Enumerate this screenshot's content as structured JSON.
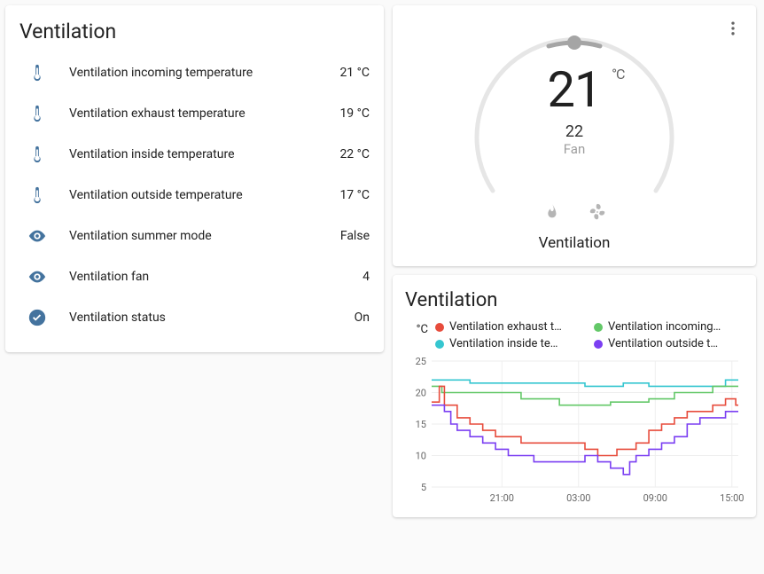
{
  "sensors_card": {
    "title": "Ventilation",
    "rows": [
      {
        "icon": "thermometer-icon",
        "label": "Ventilation incoming temperature",
        "value": "21 °C"
      },
      {
        "icon": "thermometer-icon",
        "label": "Ventilation exhaust temperature",
        "value": "19 °C"
      },
      {
        "icon": "thermometer-icon",
        "label": "Ventilation inside temperature",
        "value": "22 °C"
      },
      {
        "icon": "thermometer-icon",
        "label": "Ventilation outside temperature",
        "value": "17 °C"
      },
      {
        "icon": "eye-icon",
        "label": "Ventilation summer mode",
        "value": "False"
      },
      {
        "icon": "eye-icon",
        "label": "Ventilation fan",
        "value": "4"
      },
      {
        "icon": "check-circle-icon",
        "label": "Ventilation status",
        "value": "On"
      }
    ]
  },
  "thermostat": {
    "current_temp": "21",
    "unit": "°C",
    "target_temp": "22",
    "mode": "Fan",
    "name": "Ventilation",
    "buttons": {
      "heat": "heat",
      "fan": "fan"
    }
  },
  "chart": {
    "title": "Ventilation",
    "unit": "°C",
    "legend": [
      {
        "label": "Ventilation exhaust t…",
        "color": "#e74c3c"
      },
      {
        "label": "Ventilation incoming…",
        "color": "#63c868"
      },
      {
        "label": "Ventilation inside te…",
        "color": "#35c6d0"
      },
      {
        "label": "Ventilation outside t…",
        "color": "#7b3ff2"
      }
    ]
  },
  "chart_data": {
    "type": "line",
    "ylabel": "°C",
    "ylim": [
      5,
      25
    ],
    "yticks": [
      5,
      10,
      15,
      20,
      25
    ],
    "x_span_hours": 24,
    "xticks": [
      "21:00",
      "03:00",
      "09:00",
      "15:00"
    ],
    "xtick_hours": [
      5.5,
      11.5,
      17.5,
      23.5
    ],
    "series": [
      {
        "name": "Ventilation inside temperature",
        "color": "#35c6d0",
        "points": [
          [
            0,
            22
          ],
          [
            3,
            22
          ],
          [
            3,
            21.5
          ],
          [
            12,
            21.5
          ],
          [
            12,
            21
          ],
          [
            15,
            21
          ],
          [
            15,
            21.5
          ],
          [
            17,
            21.5
          ],
          [
            17,
            21
          ],
          [
            23,
            21
          ],
          [
            23,
            22
          ],
          [
            24,
            22
          ]
        ]
      },
      {
        "name": "Ventilation incoming temperature",
        "color": "#63c868",
        "points": [
          [
            0,
            21
          ],
          [
            0.8,
            21
          ],
          [
            0.8,
            20
          ],
          [
            7,
            20
          ],
          [
            7,
            19
          ],
          [
            10,
            19
          ],
          [
            10,
            18
          ],
          [
            14,
            18
          ],
          [
            14,
            18.5
          ],
          [
            17,
            18.5
          ],
          [
            17,
            19
          ],
          [
            19,
            19
          ],
          [
            19,
            20
          ],
          [
            22,
            20
          ],
          [
            22,
            21
          ],
          [
            24,
            21
          ]
        ]
      },
      {
        "name": "Ventilation exhaust temperature",
        "color": "#e74c3c",
        "points": [
          [
            0,
            18.5
          ],
          [
            0.6,
            18.5
          ],
          [
            0.6,
            21
          ],
          [
            1,
            21
          ],
          [
            1,
            18
          ],
          [
            2,
            18
          ],
          [
            2,
            16
          ],
          [
            3,
            16
          ],
          [
            3,
            15
          ],
          [
            4,
            15
          ],
          [
            4,
            14
          ],
          [
            5,
            14
          ],
          [
            5,
            13
          ],
          [
            7,
            13
          ],
          [
            7,
            12
          ],
          [
            12,
            12
          ],
          [
            12,
            11
          ],
          [
            13,
            11
          ],
          [
            13,
            10
          ],
          [
            14.5,
            10
          ],
          [
            14.5,
            11
          ],
          [
            16,
            11
          ],
          [
            16,
            12
          ],
          [
            17,
            12
          ],
          [
            17,
            14
          ],
          [
            18,
            14
          ],
          [
            18,
            15
          ],
          [
            19,
            15
          ],
          [
            19,
            16
          ],
          [
            20,
            16
          ],
          [
            20,
            17
          ],
          [
            22,
            17
          ],
          [
            22,
            18
          ],
          [
            23,
            18
          ],
          [
            23,
            19
          ],
          [
            23.8,
            19
          ],
          [
            23.8,
            18
          ],
          [
            24,
            18
          ]
        ]
      },
      {
        "name": "Ventilation outside temperature",
        "color": "#7b3ff2",
        "points": [
          [
            0,
            18
          ],
          [
            1,
            18
          ],
          [
            1,
            17
          ],
          [
            1.5,
            17
          ],
          [
            1.5,
            15
          ],
          [
            2,
            15
          ],
          [
            2,
            14
          ],
          [
            3,
            14
          ],
          [
            3,
            13
          ],
          [
            4,
            13
          ],
          [
            4,
            12
          ],
          [
            5,
            12
          ],
          [
            5,
            11
          ],
          [
            6,
            11
          ],
          [
            6,
            10
          ],
          [
            8,
            10
          ],
          [
            8,
            9
          ],
          [
            12,
            9
          ],
          [
            12,
            10
          ],
          [
            13,
            10
          ],
          [
            13,
            9
          ],
          [
            14,
            9
          ],
          [
            14,
            8
          ],
          [
            15,
            8
          ],
          [
            15,
            7
          ],
          [
            15.5,
            7
          ],
          [
            15.5,
            9
          ],
          [
            16,
            9
          ],
          [
            16,
            10
          ],
          [
            17,
            10
          ],
          [
            17,
            11
          ],
          [
            18,
            11
          ],
          [
            18,
            12
          ],
          [
            19,
            12
          ],
          [
            19,
            13
          ],
          [
            20,
            13
          ],
          [
            20,
            15
          ],
          [
            21,
            15
          ],
          [
            21,
            16
          ],
          [
            23,
            16
          ],
          [
            23,
            17
          ],
          [
            24,
            17
          ]
        ]
      }
    ]
  }
}
